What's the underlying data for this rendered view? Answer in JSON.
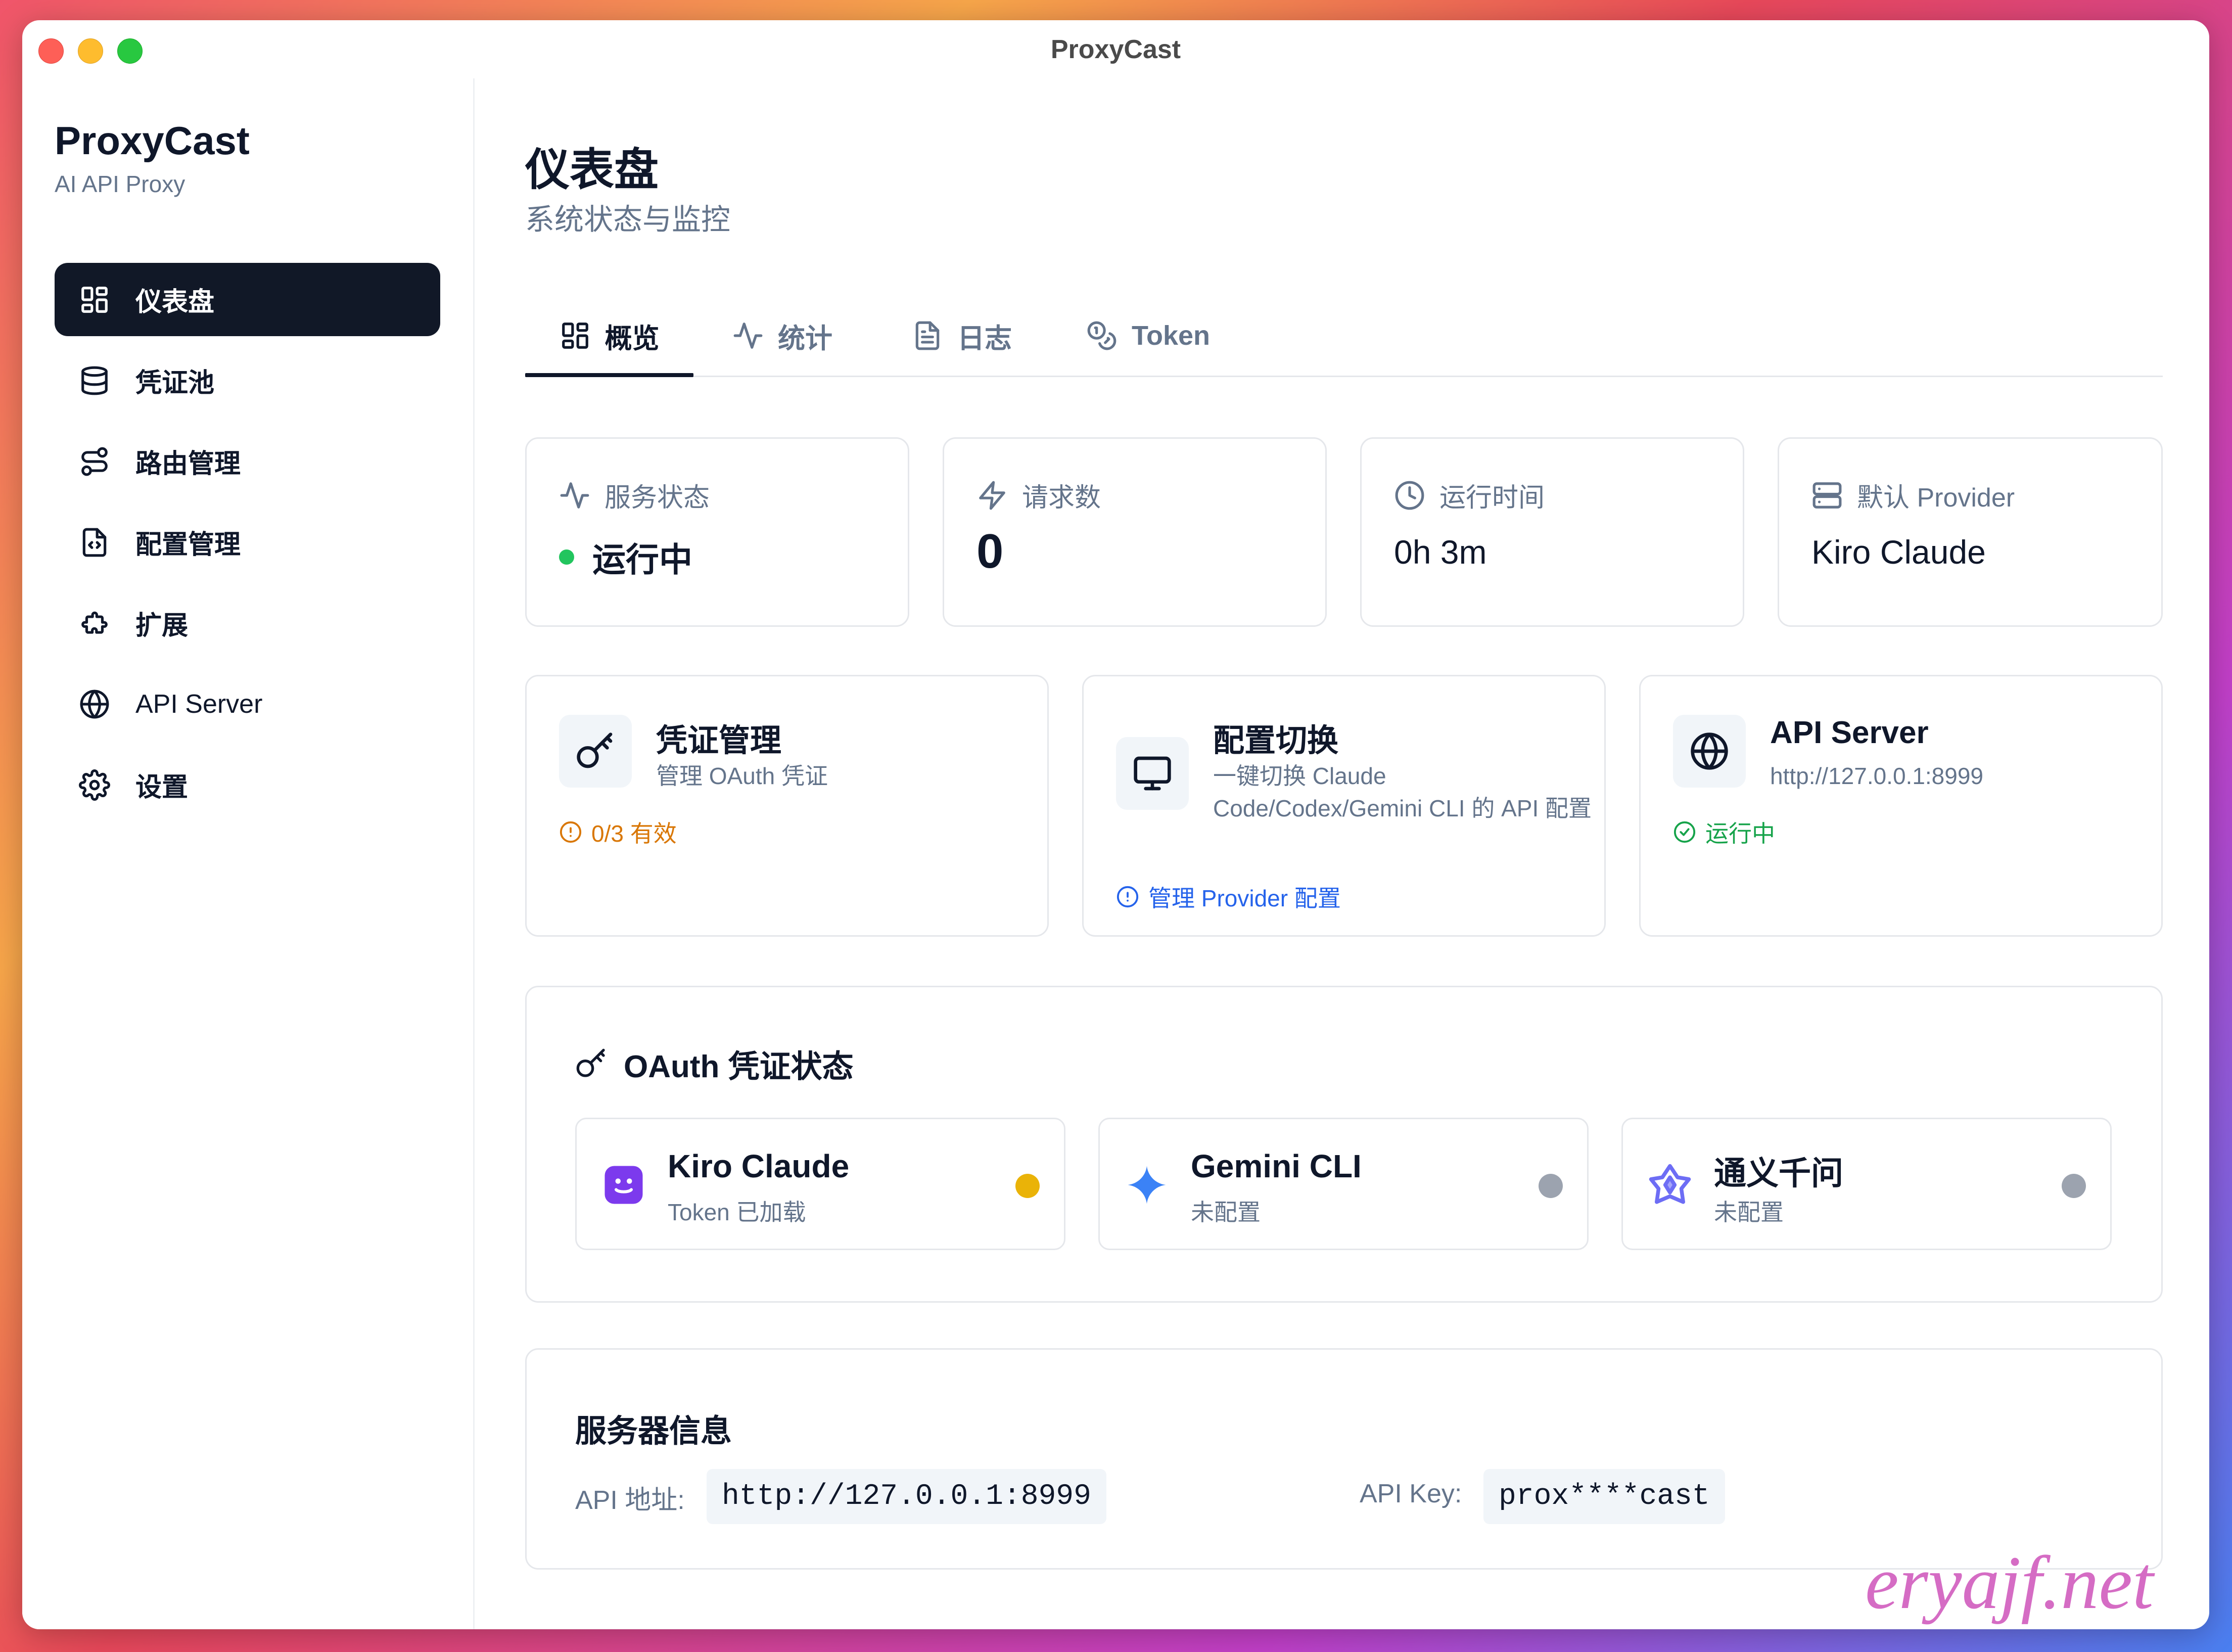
{
  "window": {
    "title": "ProxyCast"
  },
  "sidebar": {
    "app_name": "ProxyCast",
    "app_subtitle": "AI API Proxy",
    "items": [
      {
        "label": "仪表盘",
        "icon": "dashboard-icon",
        "active": true
      },
      {
        "label": "凭证池",
        "icon": "database-icon"
      },
      {
        "label": "路由管理",
        "icon": "route-icon"
      },
      {
        "label": "配置管理",
        "icon": "file-config-icon"
      },
      {
        "label": "扩展",
        "icon": "puzzle-icon"
      },
      {
        "label": "API Server",
        "icon": "globe-icon"
      },
      {
        "label": "设置",
        "icon": "gear-icon"
      }
    ]
  },
  "header": {
    "title": "仪表盘",
    "subtitle": "系统状态与监控"
  },
  "tabs": [
    {
      "label": "概览",
      "icon": "dashboard-icon",
      "active": true
    },
    {
      "label": "统计",
      "icon": "activity-icon"
    },
    {
      "label": "日志",
      "icon": "document-icon"
    },
    {
      "label": "Token",
      "icon": "coins-icon"
    }
  ],
  "stats": [
    {
      "label": "服务状态",
      "value": "运行中",
      "icon": "activity-icon",
      "status_color": "#22c55e"
    },
    {
      "label": "请求数",
      "value": "0",
      "icon": "lightning-icon"
    },
    {
      "label": "运行时间",
      "value": "0h 3m",
      "icon": "clock-icon"
    },
    {
      "label": "默认 Provider",
      "value": "Kiro Claude",
      "icon": "server-icon"
    }
  ],
  "quick_actions": [
    {
      "title": "凭证管理",
      "subtitle": "管理 OAuth 凭证",
      "status": "0/3 有效",
      "status_color": "#d97706",
      "icon": "key-icon",
      "status_icon": "alert-circle-icon"
    },
    {
      "title": "配置切换",
      "subtitle": "一键切换 Claude Code/Codex/Gemini CLI 的 API 配置",
      "status": "管理 Provider 配置",
      "status_color": "#2563eb",
      "icon": "monitor-icon",
      "status_icon": "alert-circle-icon"
    },
    {
      "title": "API Server",
      "subtitle": "http://127.0.0.1:8999",
      "status": "运行中",
      "status_color": "#16a34a",
      "icon": "globe-icon",
      "status_icon": "check-circle-icon"
    }
  ],
  "oauth": {
    "title": "OAuth 凭证状态",
    "providers": [
      {
        "name": "Kiro Claude",
        "status": "Token 已加载",
        "dot_color": "#eab308",
        "icon": "kiro-icon"
      },
      {
        "name": "Gemini CLI",
        "status": "未配置",
        "dot_color": "#9ca3af",
        "icon": "gemini-icon"
      },
      {
        "name": "通义千问",
        "status": "未配置",
        "dot_color": "#9ca3af",
        "icon": "qwen-icon"
      }
    ]
  },
  "server_info": {
    "title": "服务器信息",
    "api_address_label": "API 地址:",
    "api_address": "http://127.0.0.1:8999",
    "api_key_label": "API Key:",
    "api_key": "prox****cast"
  },
  "watermark": "eryajf.net"
}
